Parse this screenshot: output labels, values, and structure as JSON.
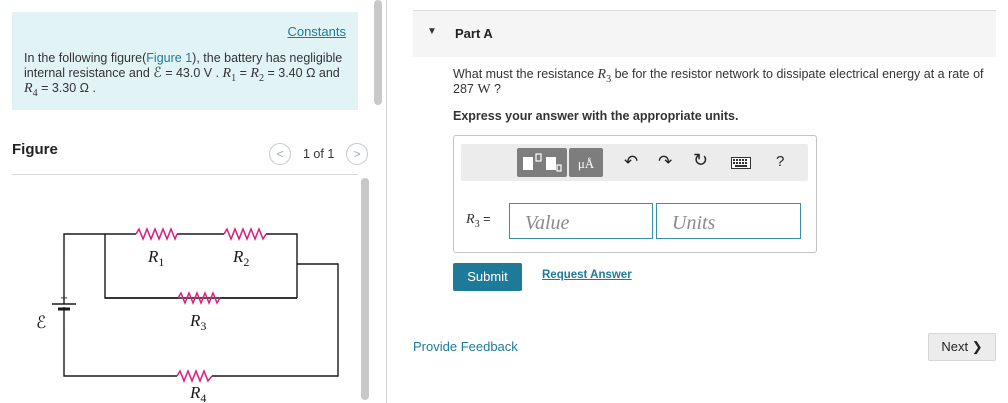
{
  "left": {
    "constants_link": "Constants",
    "problem": {
      "intro": "In the following figure(",
      "figure_link": "Figure 1",
      "mid": "), the battery has negligible internal resistance and ",
      "emf_symbol": "ℰ",
      "emf_value": " = 43.0 V . ",
      "r1_sym": "R",
      "r1_sub": "1",
      "eq1": " = ",
      "r2_sym": "R",
      "r2_sub": "2",
      "r12_value": " = 3.40 Ω and ",
      "r4_sym": "R",
      "r4_sub": "4",
      "r4_value": " = 3.30 Ω ."
    },
    "figure_heading": "Figure",
    "figure_nav": {
      "counter": "1 of 1",
      "prev_glyph": "<",
      "next_glyph": ">"
    },
    "circuit": {
      "emf_label": "ℰ",
      "plus_label": "+",
      "r1": {
        "sym": "R",
        "sub": "1"
      },
      "r2": {
        "sym": "R",
        "sub": "2"
      },
      "r3": {
        "sym": "R",
        "sub": "3"
      },
      "r4": {
        "sym": "R",
        "sub": "4"
      },
      "wire_color": "#1a1a1a",
      "resistor_color": "#e0197d"
    }
  },
  "right": {
    "part_title": "Part A",
    "question": {
      "pre": "What must the resistance ",
      "r_sym": "R",
      "r_sub": "3",
      "post": " be for the resistor network to dissipate electrical energy at a rate of 287 ",
      "unit": "W",
      "end": " ?"
    },
    "instruction": "Express your answer with the appropriate units.",
    "toolbar": {
      "units_glyph": "μÅ",
      "help_glyph": "?"
    },
    "answer": {
      "label_sym": "R",
      "label_sub": "3",
      "label_eq": " =",
      "value_placeholder": "Value",
      "units_placeholder": "Units"
    },
    "submit_label": "Submit",
    "request_answer": "Request Answer",
    "feedback": "Provide Feedback",
    "next_label": "Next"
  },
  "colors": {
    "accent": "#1f7a99",
    "problem_bg": "#e1f3f5",
    "toolbar_bg": "#ececec"
  }
}
